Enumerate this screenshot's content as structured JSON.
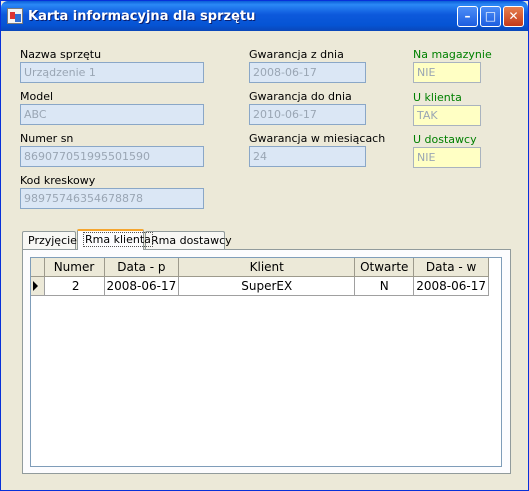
{
  "window": {
    "title": "Karta informacyjna dla sprzętu"
  },
  "fields": {
    "nazwa": {
      "label": "Nazwa sprzętu",
      "value": "Urządzenie 1"
    },
    "model": {
      "label": "Model",
      "value": "ABC"
    },
    "numer_sn": {
      "label": "Numer sn",
      "value": "869077051995501590"
    },
    "kod_kreskowy": {
      "label": "Kod kreskowy",
      "value": "98975746354678878"
    },
    "gwarancja_z": {
      "label": "Gwarancja z dnia",
      "value": "2008-06-17"
    },
    "gwarancja_do": {
      "label": "Gwarancja do dnia",
      "value": "2010-06-17"
    },
    "gwarancja_mies": {
      "label": "Gwarancja w miesiącach",
      "value": "24"
    },
    "na_magazynie": {
      "label": "Na magazynie",
      "value": "NIE"
    },
    "u_klienta": {
      "label": "U klienta",
      "value": "TAK"
    },
    "u_dostawcy": {
      "label": "U dostawcy",
      "value": "NIE"
    }
  },
  "tabs": [
    {
      "label": "Przyjęcie"
    },
    {
      "label": "Rma klienta",
      "active": true
    },
    {
      "label": "Rma dostawcy"
    }
  ],
  "grid": {
    "columns": [
      "Numer",
      "Data - p",
      "Klient",
      "Otwarte",
      "Data - w"
    ],
    "rows": [
      {
        "numer": "2",
        "data_p": "2008-06-17",
        "klient": "SuperEX",
        "otwarte": "N",
        "data_w": "2008-06-17"
      }
    ]
  },
  "colors": {
    "title_bar": "#0a5fd8",
    "green_label": "#008000",
    "field_bg": "#dbe7f5",
    "status_bg": "#ffffc4",
    "active_tab_accent": "#f5a52e"
  }
}
